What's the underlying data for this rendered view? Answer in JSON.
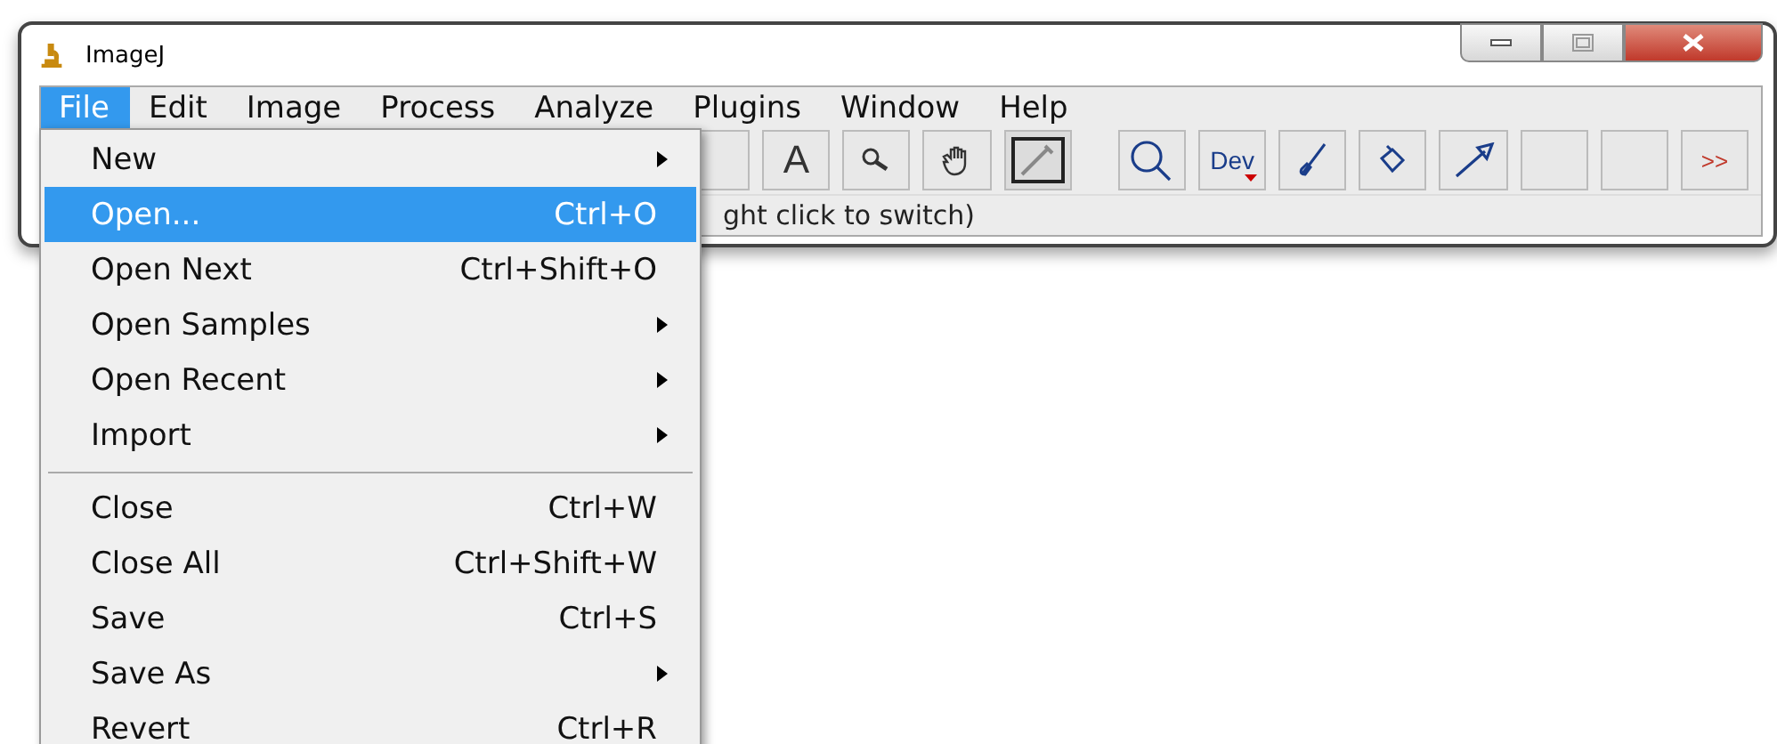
{
  "window": {
    "title": "ImageJ"
  },
  "menubar": [
    {
      "label": "File",
      "selected": true
    },
    {
      "label": "Edit",
      "selected": false
    },
    {
      "label": "Image",
      "selected": false
    },
    {
      "label": "Process",
      "selected": false
    },
    {
      "label": "Analyze",
      "selected": false
    },
    {
      "label": "Plugins",
      "selected": false
    },
    {
      "label": "Window",
      "selected": false
    },
    {
      "label": "Help",
      "selected": false
    }
  ],
  "toolbar": [
    {
      "kind": "blank",
      "selected": false
    },
    {
      "kind": "text",
      "text": "A",
      "selected": false
    },
    {
      "kind": "magnifier",
      "selected": false
    },
    {
      "kind": "hand",
      "selected": false
    },
    {
      "kind": "dropper",
      "selected": true
    },
    {
      "kind": "gap"
    },
    {
      "kind": "zoom",
      "selected": false
    },
    {
      "kind": "dev",
      "text": "Dev",
      "selected": false
    },
    {
      "kind": "brush",
      "selected": false
    },
    {
      "kind": "fill",
      "selected": false
    },
    {
      "kind": "arrow",
      "selected": false
    },
    {
      "kind": "blank",
      "selected": false
    },
    {
      "kind": "blank",
      "selected": false
    },
    {
      "kind": "more",
      "text": ">>",
      "selected": false
    }
  ],
  "status_bar": "ght click to switch)",
  "file_menu": [
    {
      "kind": "item",
      "label": "New",
      "submenu": true,
      "selected": false
    },
    {
      "kind": "item",
      "label": "Open...",
      "shortcut": "Ctrl+O",
      "submenu": false,
      "selected": true
    },
    {
      "kind": "item",
      "label": "Open Next",
      "shortcut": "Ctrl+Shift+O",
      "submenu": false,
      "selected": false
    },
    {
      "kind": "item",
      "label": "Open Samples",
      "submenu": true,
      "selected": false
    },
    {
      "kind": "item",
      "label": "Open Recent",
      "submenu": true,
      "selected": false
    },
    {
      "kind": "item",
      "label": "Import",
      "submenu": true,
      "selected": false
    },
    {
      "kind": "separator"
    },
    {
      "kind": "item",
      "label": "Close",
      "shortcut": "Ctrl+W",
      "submenu": false,
      "selected": false
    },
    {
      "kind": "item",
      "label": "Close All",
      "shortcut": "Ctrl+Shift+W",
      "submenu": false,
      "selected": false
    },
    {
      "kind": "item",
      "label": "Save",
      "shortcut": "Ctrl+S",
      "submenu": false,
      "selected": false
    },
    {
      "kind": "item",
      "label": "Save As",
      "submenu": true,
      "selected": false
    },
    {
      "kind": "item",
      "label": "Revert",
      "shortcut": "Ctrl+R",
      "submenu": false,
      "selected": false
    }
  ]
}
